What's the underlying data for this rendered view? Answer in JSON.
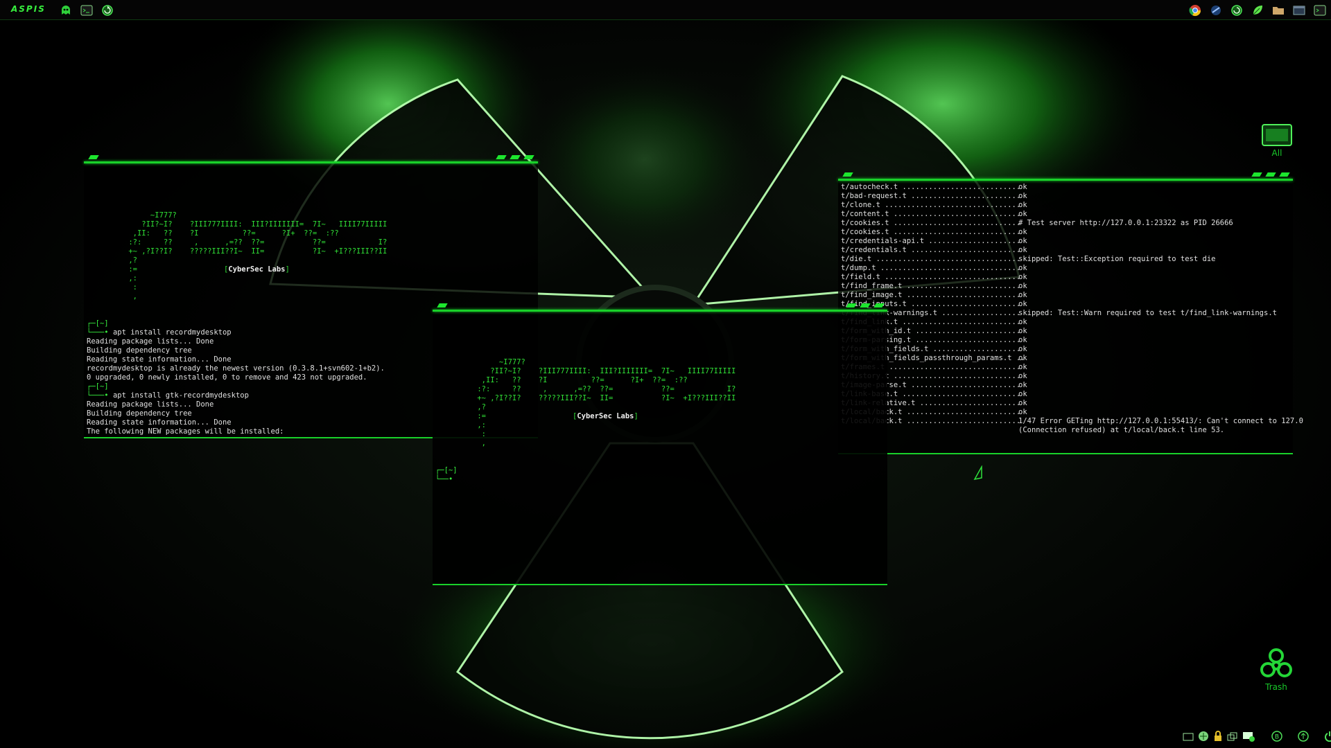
{
  "panel": {
    "logo": "ASPIS",
    "left_icons": [
      "ghost-icon",
      "terminal-icon",
      "refresh-icon"
    ],
    "right_icons": [
      "chrome-icon",
      "app-icon",
      "refresh-icon",
      "leaf-icon",
      "folder-icon",
      "window-icon",
      "terminal-icon"
    ]
  },
  "ascii_art": "      ~I777?\n    ?II?~I?    ?III777IIII:  III?IIIIIII=  7I~   IIII77IIIII\n  ,II:   ??    ?I          ??=      ?I+  ??=  :??\n :?:     ??     ,      ,=??  ??=           ??=            I?\n +~ ,?I??I?    ?????III??I~  II=           ?I~  +I???III??II\n ,?\n :=\n ,:\n  :\n  ,",
  "brand_text": "CyberSec Labs",
  "brand_left": "[",
  "brand_right": "]",
  "prompt_home": "[~]",
  "window1": {
    "lines": [
      {
        "kind": "prompt",
        "text": "[~]"
      },
      {
        "kind": "cmd",
        "text": "apt install recordmydesktop"
      },
      {
        "kind": "out",
        "text": "Reading package lists... Done"
      },
      {
        "kind": "out",
        "text": "Building dependency tree"
      },
      {
        "kind": "out",
        "text": "Reading state information... Done"
      },
      {
        "kind": "out",
        "text": "recordmydesktop is already the newest version (0.3.8.1+svn602-1+b2)."
      },
      {
        "kind": "out",
        "text": "0 upgraded, 0 newly installed, 0 to remove and 423 not upgraded."
      },
      {
        "kind": "prompt",
        "text": "[~]"
      },
      {
        "kind": "cmd",
        "text": "apt install gtk-recordmydesktop"
      },
      {
        "kind": "out",
        "text": "Reading package lists... Done"
      },
      {
        "kind": "out",
        "text": "Building dependency tree"
      },
      {
        "kind": "out",
        "text": "Reading state information... Done"
      },
      {
        "kind": "out",
        "text": "The following NEW packages will be installed:"
      }
    ]
  },
  "window3": {
    "lines": [
      {
        "name": "t/autocheck.t ...........................",
        "res": "ok"
      },
      {
        "name": "t/bad-request.t .........................",
        "res": "ok"
      },
      {
        "name": "t/clone.t ...............................",
        "res": "ok"
      },
      {
        "name": "t/content.t .............................",
        "res": "ok"
      },
      {
        "name": "t/cookies.t .............................",
        "res": "# Test server http://127.0.0.1:23322 as PID 26666"
      },
      {
        "name": "t/cookies.t .............................",
        "res": "ok"
      },
      {
        "name": "t/credentials-api.t .....................",
        "res": "ok"
      },
      {
        "name": "t/credentials.t .........................",
        "res": "ok"
      },
      {
        "name": "t/die.t .................................",
        "res": "skipped: Test::Exception required to test die"
      },
      {
        "name": "t/dump.t ................................",
        "res": "ok"
      },
      {
        "name": "t/field.t ...............................",
        "res": "ok"
      },
      {
        "name": "t/find_frame.t ..........................",
        "res": "ok"
      },
      {
        "name": "t/find_image.t ..........................",
        "res": "ok"
      },
      {
        "name": "t/find_inputs.t .........................",
        "res": "ok"
      },
      {
        "name": "t/find_link-warnings.t ..................",
        "res": "skipped: Test::Warn required to test t/find_link-warnings.t"
      },
      {
        "name": "t/find_link.t ...........................",
        "res": "ok"
      },
      {
        "name": "t/form_with_id.t ........................",
        "res": "ok"
      },
      {
        "name": "t/form-parsing.t ........................",
        "res": "ok"
      },
      {
        "name": "t/form_with_fields.t ....................",
        "res": "ok"
      },
      {
        "name": "t/form_with_fields_passthrough_params.t ..",
        "res": "ok"
      },
      {
        "name": "t/frames.t ..............................",
        "res": "ok"
      },
      {
        "name": "t/history.t .............................",
        "res": "ok"
      },
      {
        "name": "t/image-parse.t .........................",
        "res": "ok"
      },
      {
        "name": "t/link-base.t ...........................",
        "res": "ok"
      },
      {
        "name": "t/link-relative.t .......................",
        "res": "ok"
      },
      {
        "name": "t/local/back.t ..........................",
        "res": "ok"
      },
      {
        "name": "t/local/back.t ..........................",
        "res": "1/47 Error GETing http://127.0.0.1:55413/: Can't connect to 127.0"
      },
      {
        "name": "",
        "res": "(Connection refused) at t/local/back.t line 53."
      }
    ]
  },
  "desktop": {
    "all_label": "All",
    "trash_label": "Trash"
  },
  "tray_icons": [
    "folder-icon",
    "network-icon",
    "lock-icon",
    "windows-icon",
    "display-icon",
    "p2p-icon",
    "vpn-icon",
    "power-icon"
  ],
  "colors": {
    "accent": "#19d12a",
    "text": "#e0e0e0",
    "background": "#000000"
  }
}
